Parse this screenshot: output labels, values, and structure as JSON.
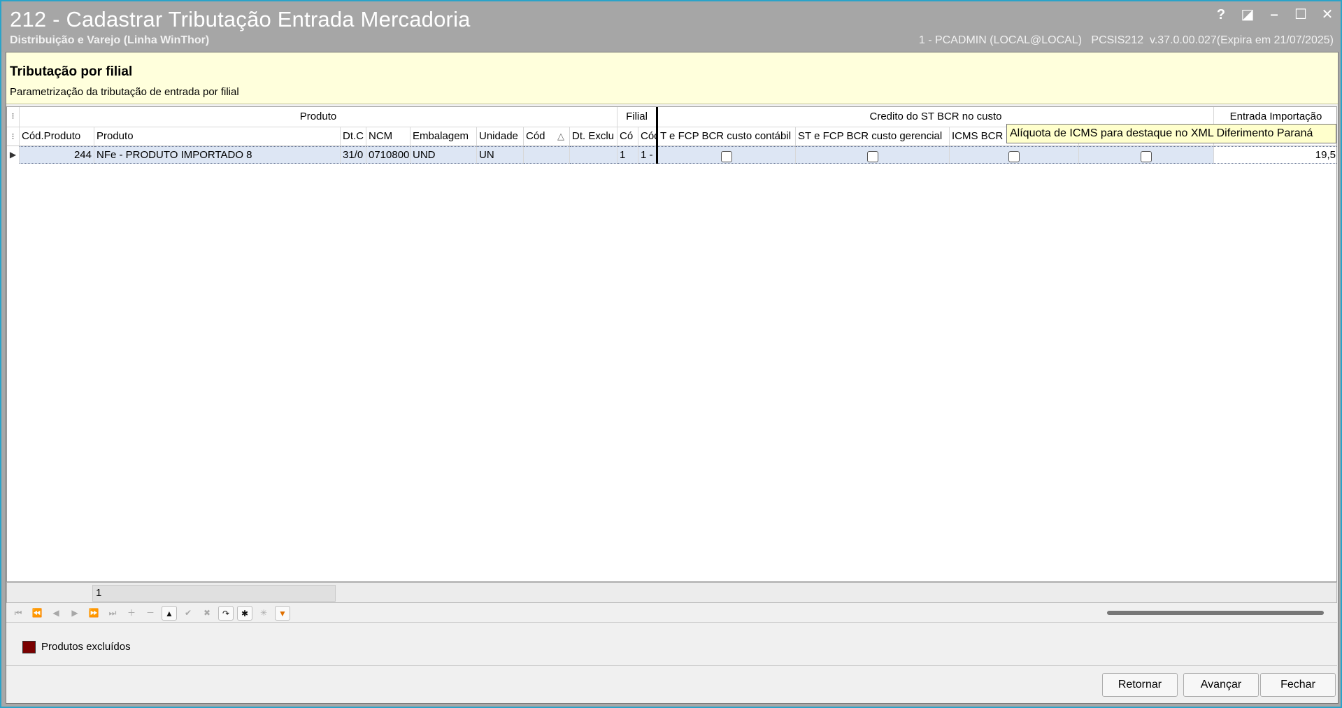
{
  "window": {
    "title": "212 - Cadastrar Tributação Entrada Mercadoria",
    "subtitle": "Distribuição e Varejo (Linha WinThor)",
    "user_info": "1 - PCADMIN (LOCAL@LOCAL)   PCSIS212  v.37.0.00.027(Expira em 21/07/2025)",
    "controls": [
      "?",
      "◪",
      "–",
      "☐",
      "✕"
    ]
  },
  "hint": {
    "title": "Tributação por filial",
    "description": "Parametrização da tributação de entrada por filial"
  },
  "grid": {
    "bands": {
      "produto": "Produto",
      "filial": "Filial",
      "credito": "Credito do ST BCR no custo",
      "importacao": "Entrada Importação"
    },
    "columns": {
      "cod_produto": "Cód.Produto",
      "produto": "Produto",
      "dt_c": "Dt.C",
      "ncm": "NCM",
      "embalagem": "Embalagem",
      "unidade": "Unidade",
      "cod": "Cód",
      "dt_excl": "Dt. Exclu",
      "filial_cod1": "Có",
      "filial_cod2": "Cód",
      "st_fcp_contabil": "T e FCP BCR custo contábil",
      "st_fcp_gerencial": "ST e FCP BCR custo gerencial",
      "icms_bcr": "ICMS BCR c",
      "entrada_imp": ""
    },
    "sort_indicator": "△",
    "rows": [
      {
        "cod_produto": "244",
        "produto": "NFe - PRODUTO IMPORTADO 8",
        "dt_c": "31/0",
        "ncm": "0710800",
        "embalagem": "UND",
        "unidade": "UN",
        "cod": "",
        "dt_excl": "",
        "filial_cod1": "1",
        "filial_cod2": "1 -",
        "st_fcp_contabil": false,
        "st_fcp_gerencial": false,
        "icms_bcr": false,
        "extra_check": false,
        "entrada_importacao": "19,5"
      }
    ],
    "tooltip": "Alíquota de ICMS para destaque no XML Diferimento Paraná",
    "footer_count": "1"
  },
  "legend": {
    "excluded_label": "Produtos excluídos",
    "excluded_color": "#7a0000"
  },
  "actions": {
    "back": "Retornar",
    "next": "Avançar",
    "close": "Fechar"
  }
}
